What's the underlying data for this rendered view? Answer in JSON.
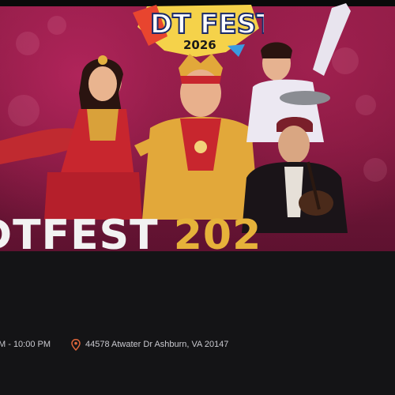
{
  "banner": {
    "badge_title": "DT FEST",
    "badge_year": "2026",
    "big_title_white": "DTFEST",
    "big_title_gold": "202"
  },
  "event": {
    "time": "M  - 10:00 PM",
    "location_icon": "map-pin-icon",
    "address": "44578 Atwater Dr Ashburn, VA 20147"
  },
  "colors": {
    "background": "#141416",
    "banner": "#8e1c45",
    "badge_yellow": "#f5d24a",
    "title_gold": "#e6b23a",
    "pin_orange": "#e0663a"
  }
}
